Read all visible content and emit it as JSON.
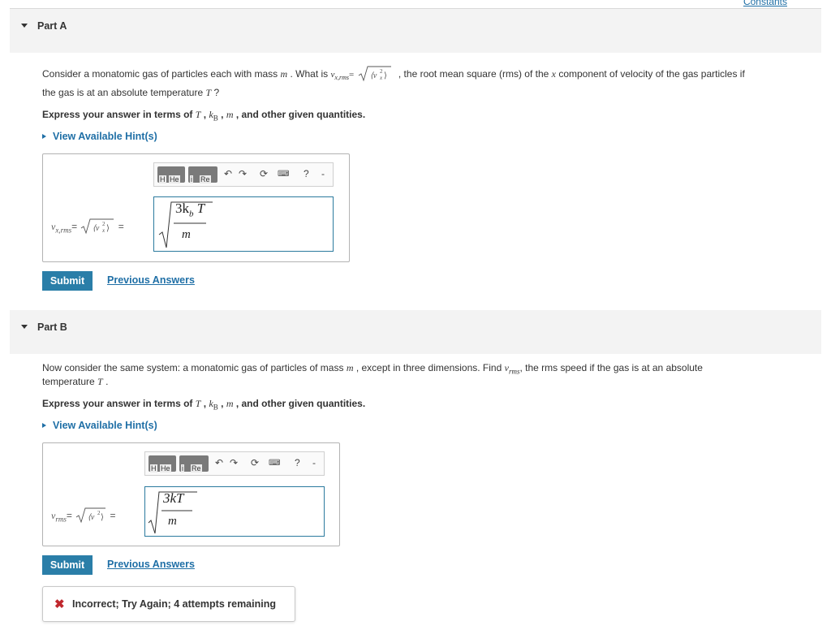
{
  "header": {
    "constants_link": "Constants"
  },
  "part_a": {
    "title": "Part A",
    "question_pre": "Consider a monatomic gas of particles each with mass",
    "var_m": "m",
    "question_mid": ". What is",
    "var_vx_rms": "v",
    "vx_rms_sub": "x,rms",
    "vx_rms_eq": "=",
    "question_post": ", the root mean square (rms) of the",
    "var_x": "x",
    "question_post2": "component of velocity of the gas particles if",
    "question_line2": "the gas is at an absolute temperature",
    "var_T": "T",
    "question_end": "?",
    "express_pre": "Express your answer in terms of",
    "express_T": "T",
    "express_kB": "k",
    "express_kB_sub": "B",
    "express_m": "m",
    "express_post": ", and other given quantities.",
    "hint_label": "View Available Hint(s)",
    "lhs_v": "v",
    "lhs_sub": "x,rms",
    "lhs_eq": "=",
    "lhs_trail": "=",
    "answer_numerator": "3k",
    "answer_numerator_sub": "b",
    "answer_numerator_T": "T",
    "answer_denominator": "m",
    "submit_label": "Submit",
    "previous_label": "Previous Answers",
    "toolbar": {
      "btn1_sub": "H",
      "btn1_sub2": "He",
      "btn2_sub": "i",
      "btn2_sub2": "Re",
      "help": "?",
      "dash": "-"
    }
  },
  "part_b": {
    "title": "Part B",
    "question_pre": "Now consider the same system: a monatomic gas of particles of mass",
    "var_m": "m",
    "question_mid": ", except in three dimensions. Find",
    "var_v": "v",
    "v_sub": "rms",
    "question_post": ", the rms speed if the gas is at an absolute",
    "question_line2": "temperature",
    "var_T": "T",
    "question_end": ".",
    "express_pre": "Express your answer in terms of",
    "express_T": "T",
    "express_kB": "k",
    "express_kB_sub": "B",
    "express_m": "m",
    "express_post": ", and other given quantities.",
    "hint_label": "View Available Hint(s)",
    "lhs_v": "v",
    "lhs_sub": "rms",
    "lhs_eq": "=",
    "lhs_trail": "=",
    "answer_numerator": "3kT",
    "answer_denominator": "m",
    "submit_label": "Submit",
    "previous_label": "Previous Answers",
    "toolbar": {
      "btn1_sub": "H",
      "btn1_sub2": "He",
      "btn2_sub": "i",
      "btn2_sub2": "Re",
      "help": "?",
      "dash": "-"
    },
    "feedback": "Incorrect; Try Again; 4 attempts remaining"
  }
}
